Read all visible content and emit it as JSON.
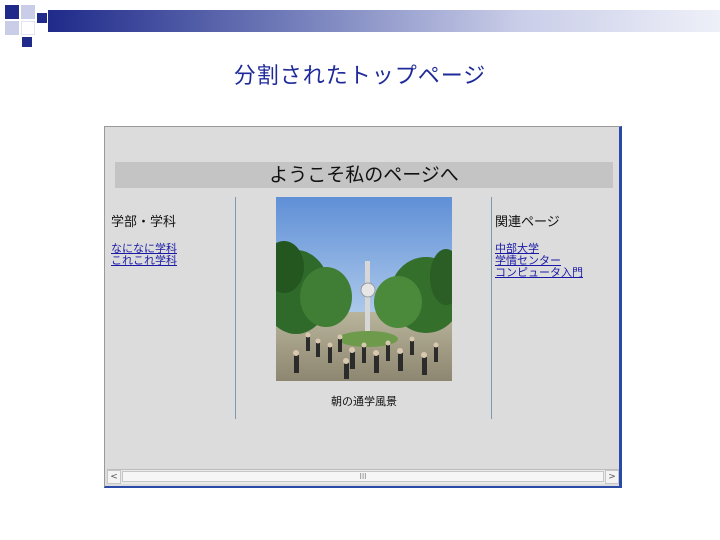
{
  "slide": {
    "title": "分割されたトップページ"
  },
  "page": {
    "welcome": "ようこそ私のページへ",
    "left": {
      "heading": "学部・学科",
      "links": [
        "なになに学科",
        "これこれ学科"
      ]
    },
    "right": {
      "heading": "関連ページ",
      "links": [
        "中部大学",
        "学情センター",
        "コンピュータ入門"
      ]
    },
    "photo_caption": "朝の通学風景"
  },
  "scrollbar": {
    "left_arrow": "<",
    "right_arrow": ">",
    "thumb_grip": "III"
  },
  "colors": {
    "title": "#1f2a9a",
    "link": "#1a1aa6",
    "window_bg": "#dcdcdc"
  }
}
